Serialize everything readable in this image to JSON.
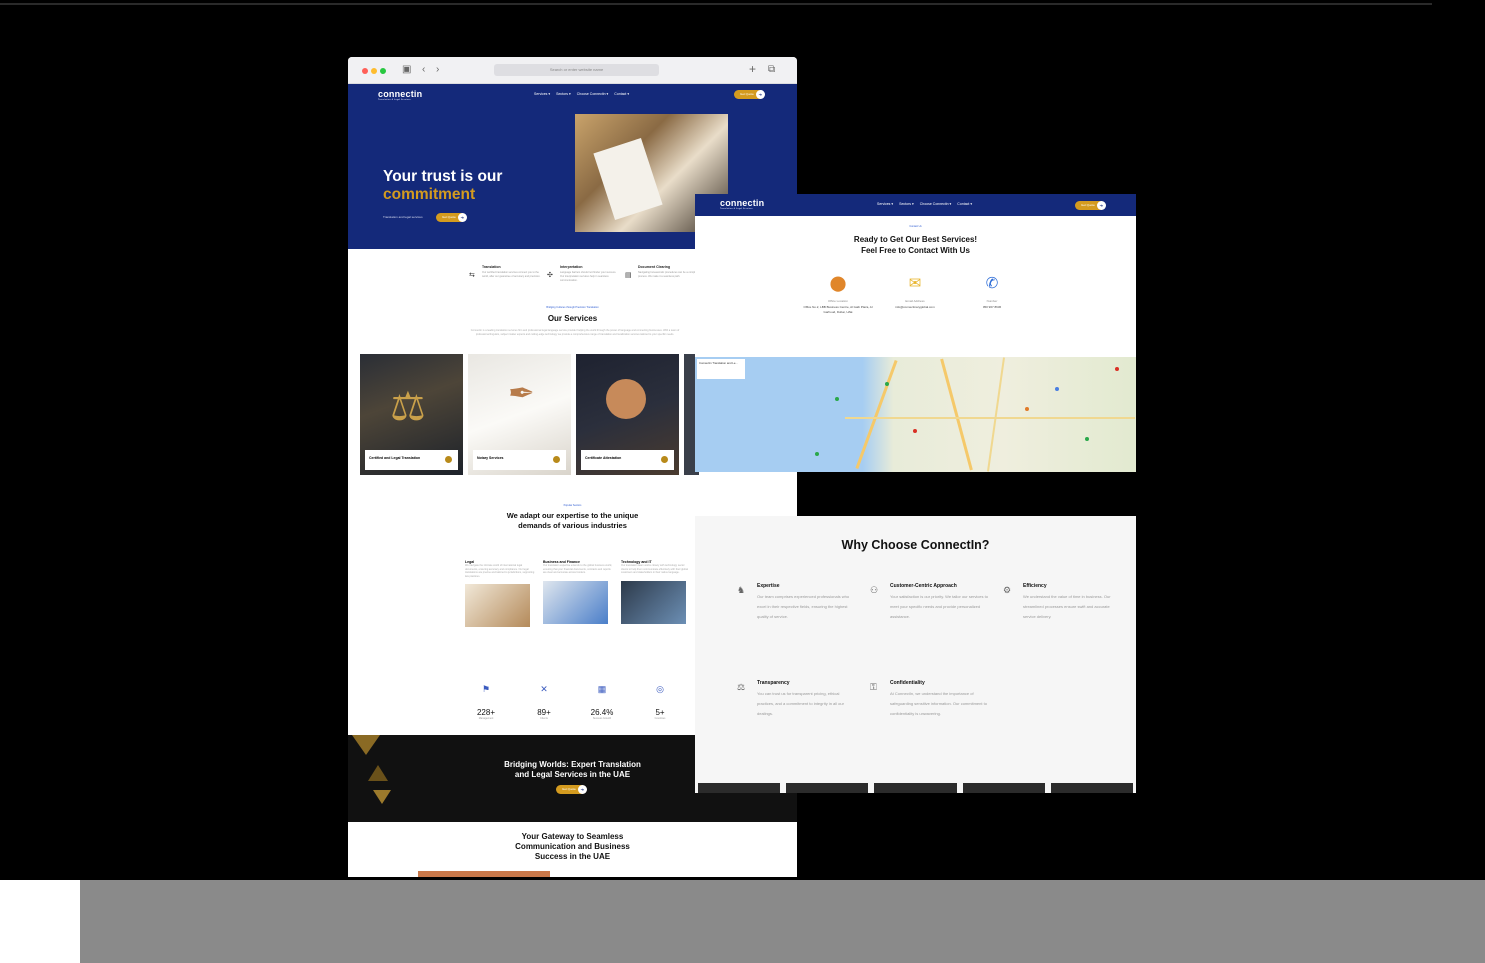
{
  "browser": {
    "url_placeholder": "Search or enter website name",
    "icons": [
      "sidebar-icon",
      "back-icon",
      "forward-icon",
      "plus-icon",
      "tabs-icon"
    ]
  },
  "site": {
    "logo": "connectin",
    "logo_tagline": "Translation & Legal Services",
    "nav": [
      "Services ▾",
      "Sectors ▾",
      "Choose Connectin ▾",
      "Contact ▾"
    ],
    "cta": "Get Quote"
  },
  "hero": {
    "line1": "Your trust is our",
    "line2": "commitment",
    "sub": "Translation and legal services"
  },
  "features": [
    {
      "title": "Translation",
      "text": "Our certified translation services connect you to the world, after our guarantee of accuracy and precision."
    },
    {
      "title": "Interpretation",
      "text": "Language barriers should not hinder your success. Our interpretation services help in seamless communication."
    },
    {
      "title": "Document Clearing",
      "text": "Navigating bureaucratic procedures can be a complex process. We make it a seamless path."
    }
  ],
  "services": {
    "kicker": "Bridging Cultures through Precision Translation",
    "title": "Our Services",
    "text": "Connectin is a leading translation services firm and professional legal language service provider helping the world through the power of language and connecting businesses. With a team of professional linguists, subject matter experts and cutting-edge technology we provide a comprehensive range of translation and localization services tailored to your specific needs.",
    "cards": [
      "Certified and Legal Translation",
      "Notary Services",
      "Certificate Attestation"
    ]
  },
  "industries": {
    "kicker": "Popular Sectors",
    "title": "We adapt our expertise to the unique demands of various industries",
    "items": [
      {
        "title": "Legal",
        "text": "We navigate the intricate world of international legal documents, ensuring accuracy and compliance. Our legal translations are precise and tailored to jurisdictions, supporting law practices."
      },
      {
        "title": "Business and Finance",
        "text": "Our translation expertise extends to the global business world, ensuring that your financial documents, contracts and reports are clear and accurate across borders."
      },
      {
        "title": "Technology and IT",
        "text": "Our translation team works closely with technology sector clients to help them communicate effectively with their global customers and stakeholders in their native language."
      }
    ]
  },
  "stats": [
    {
      "value": "228+",
      "label": "Management"
    },
    {
      "value": "89+",
      "label": "Clients"
    },
    {
      "value": "26.4%",
      "label": "Success Growth"
    },
    {
      "value": "5+",
      "label": "Countries"
    }
  ],
  "band": {
    "line1": "Bridging Worlds: Expert Translation",
    "line2": "and Legal Services in the UAE",
    "cta": "Get Quote"
  },
  "gateway": {
    "line1": "Your Gateway to Seamless",
    "line2": "Communication and Business",
    "line3": "Success in the UAE"
  },
  "contact": {
    "kicker": "Contact Us",
    "title1": "Ready to Get Our Best Services!",
    "title2": "Feel Free to Contact With Us",
    "items": [
      {
        "label": "Office Location",
        "value": "Office No.2, LBB Business Centre, Al Gaib Plaza, Al Garhoud, Dubai, UAE"
      },
      {
        "label": "Email Address",
        "value": "info@connectinaryglobal.com"
      },
      {
        "label": "Number",
        "value": "050 967 8636"
      }
    ],
    "map_card": "Connectin Translation and Le..."
  },
  "why": {
    "title": "Why Choose ConnectIn?",
    "items": [
      {
        "title": "Expertise",
        "text": "Our team comprises experienced professionals who excel in their respective fields, ensuring the highest quality of service."
      },
      {
        "title": "Customer-Centric Approach",
        "text": "Your satisfaction is our priority. We tailor our services to meet your specific needs and provide personalized assistance."
      },
      {
        "title": "Efficiency",
        "text": "We understand the value of time in business. Our streamlined processes ensure swift and accurate service delivery."
      },
      {
        "title": "Transparency",
        "text": "You can trust us for transparent pricing, ethical practices, and a commitment to integrity in all our dealings."
      },
      {
        "title": "Confidentiality",
        "text": "At ConnectIn, we understand the importance of safeguarding sensitive information. Our commitment to confidentiality is unwavering."
      }
    ]
  },
  "colors": {
    "brand_navy": "#14297a",
    "brand_gold": "#d49b1f",
    "background": "#000000"
  }
}
